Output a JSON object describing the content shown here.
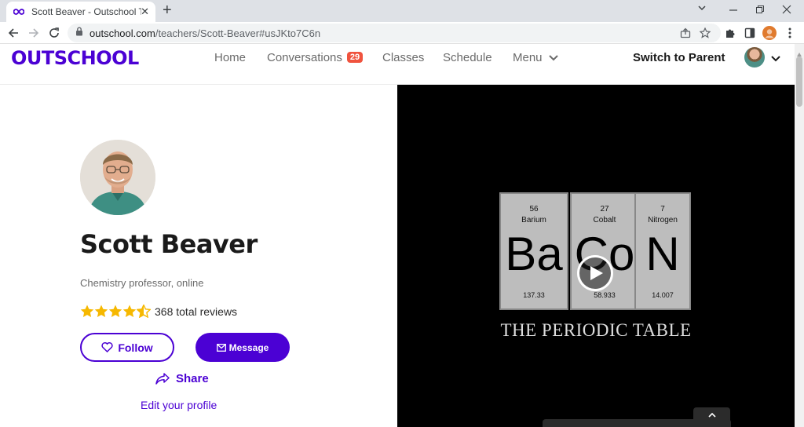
{
  "browser": {
    "tab_title": "Scott Beaver - Outschool Teacher",
    "tab_close": "✕",
    "new_tab": "+",
    "url_host": "outschool.com",
    "url_path": "/teachers/Scott-Beaver#usJKto7C6n"
  },
  "header": {
    "logo": "OUTSCHOOL",
    "nav": {
      "home": "Home",
      "conversations": "Conversations",
      "conversations_badge": "29",
      "classes": "Classes",
      "schedule": "Schedule",
      "menu": "Menu"
    },
    "switch_to_parent": "Switch to Parent"
  },
  "profile": {
    "name": "Scott Beaver",
    "headline": "Chemistry professor, online",
    "rating": 4.5,
    "reviews_text": "368 total reviews",
    "follow_label": "Follow",
    "message_label": "Message",
    "share_label": "Share",
    "edit_profile_label": "Edit your profile"
  },
  "video": {
    "tiles": [
      {
        "number": "56",
        "name": "Barium",
        "symbol": "Ba",
        "mass": "137.33"
      },
      {
        "number": "27",
        "name": "Cobalt",
        "symbol": "Co",
        "mass": "58.933"
      },
      {
        "number": "7",
        "name": "Nitrogen",
        "symbol": "N",
        "mass": "14.007"
      }
    ],
    "caption": "THE PERIODIC TABLE"
  },
  "colors": {
    "brand": "#4b01d4",
    "badge": "#f0533e",
    "star": "#f6b800"
  }
}
